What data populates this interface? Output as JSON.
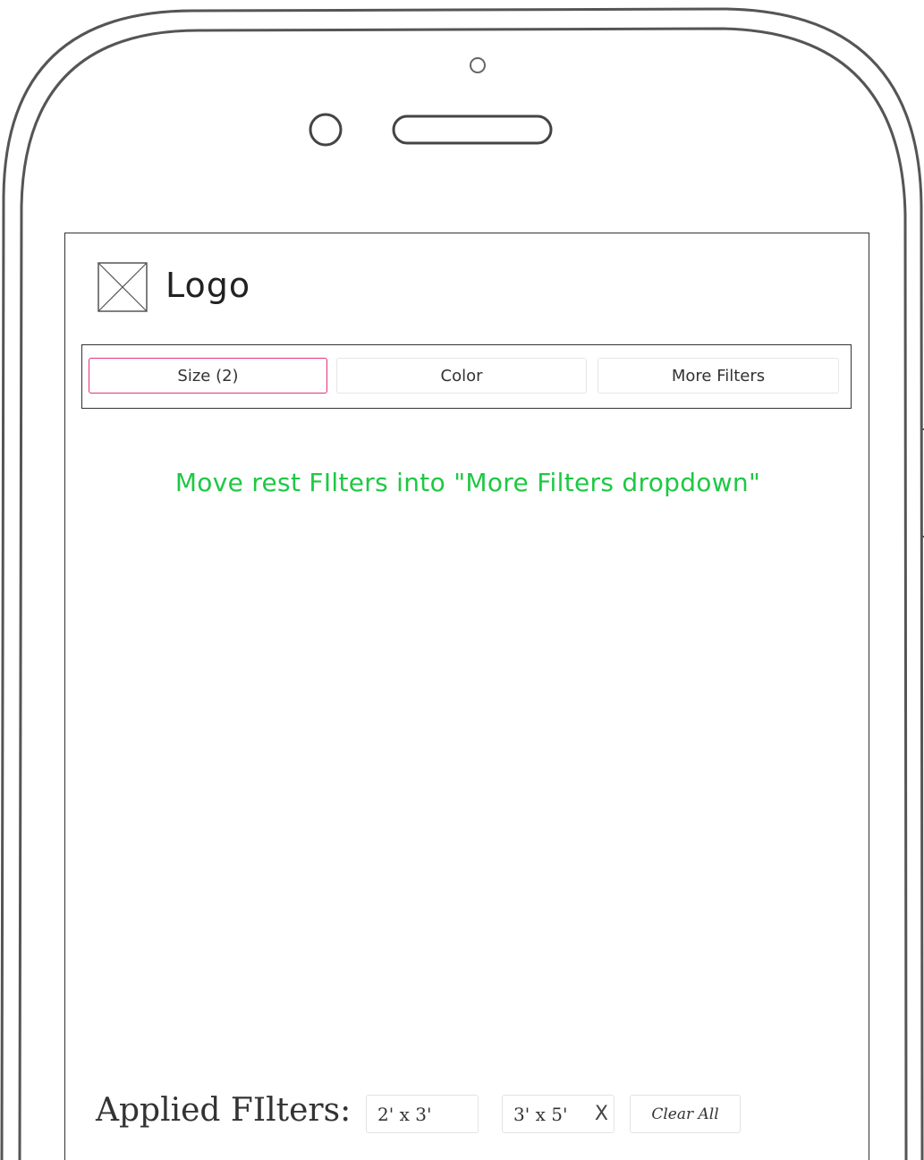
{
  "header": {
    "logo_label": "Logo"
  },
  "filters": {
    "tabs": [
      {
        "label": "Size (2)",
        "active": true
      },
      {
        "label": "Color",
        "active": false
      },
      {
        "label": "More Filters",
        "active": false
      }
    ]
  },
  "annotation": {
    "text": "Move rest FIlters into \"More Filters dropdown\"",
    "color": "#1ec844"
  },
  "applied": {
    "label": "Applied FIlters:",
    "chips": [
      {
        "label": "2' x 3'"
      },
      {
        "label": "3' x 5'",
        "close_icon": "X"
      }
    ],
    "clear_label": "Clear All"
  },
  "colors": {
    "active_tab_border": "#e0337a",
    "annotation_text": "#1ec844"
  },
  "icons": {
    "logo": "image-placeholder-icon",
    "chip_close": "close-icon"
  }
}
